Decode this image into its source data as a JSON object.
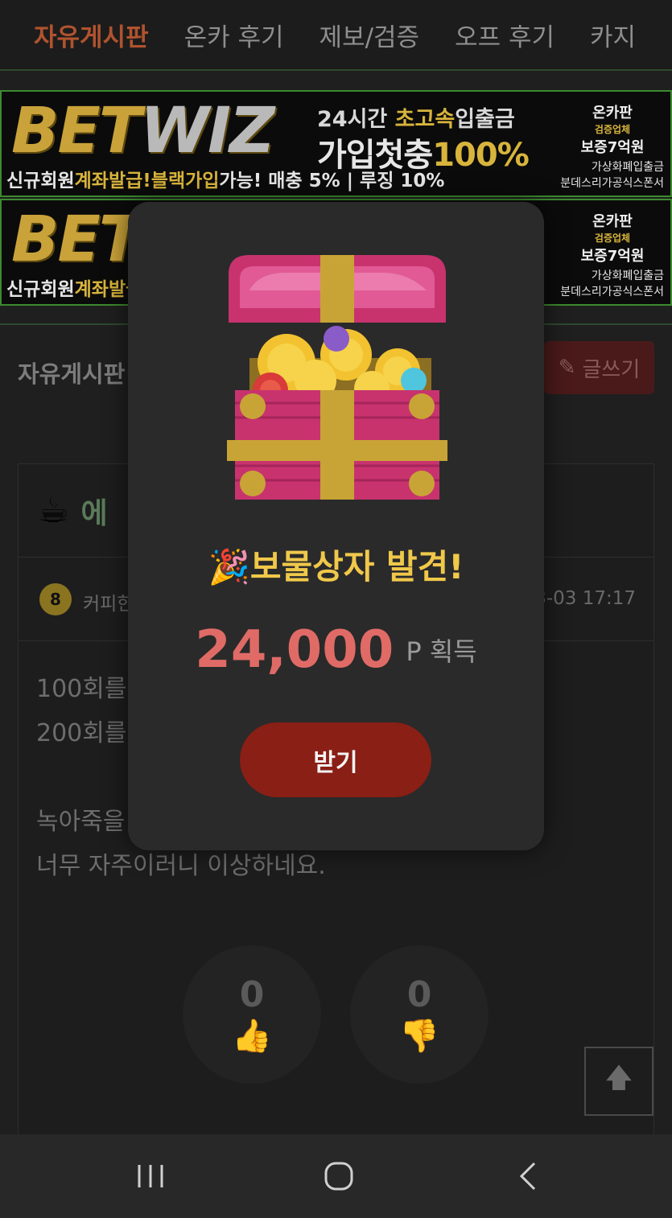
{
  "nav": {
    "tabs": [
      {
        "label": "자유게시판",
        "active": true
      },
      {
        "label": "온카 후기",
        "active": false
      },
      {
        "label": "제보/검증",
        "active": false
      },
      {
        "label": "오프 후기",
        "active": false
      },
      {
        "label": "카지",
        "active": false
      }
    ]
  },
  "banner": {
    "logo_bet": "BET",
    "logo_wiz": "WIZ",
    "tag1_pre": "24시간 ",
    "tag1_hl": "초고속",
    "tag1_post": "입출금",
    "tag2_pre": "가입첫충",
    "tag2_hl": "100%",
    "bottom_pre": "신규회원",
    "bottom_hl1": "계좌발급!",
    "bottom_mid": " ",
    "bottom_hl2": "블랙가입",
    "bottom_post": "가능!  매충 5% | 루징 10%",
    "badge_line1": "온카판",
    "badge_line2": "검증업체",
    "badge_line3": "보증7억원",
    "crypto": "가상화폐입출금",
    "sports": "분데스리가공식스폰서"
  },
  "board": {
    "title": "자유게시판",
    "write_label": "글쓰기"
  },
  "post": {
    "title_partial": "에",
    "author_level": "8",
    "author_partial": "커피한",
    "date_partial": "3-03 17:17",
    "lines": [
      "100회를",
      "200회를",
      "",
      "녹아죽을",
      "너무 자주이러니 이상하네요."
    ],
    "likes": "0",
    "dislikes": "0"
  },
  "modal": {
    "title": "🎉보물상자 발견!",
    "amount": "24,000",
    "unit": "P 획득",
    "button": "받기"
  },
  "colors": {
    "accent_red": "#8a1f15",
    "amount_red": "#e06b66",
    "title_gold": "#f0c84a",
    "active_tab": "#b0532e"
  }
}
